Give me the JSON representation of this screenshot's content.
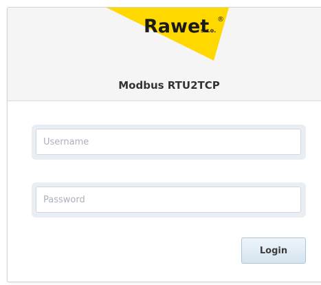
{
  "branding": {
    "logo_word": "Rawet",
    "logo_suffix": "s.r.o.",
    "logo_mark": "®",
    "logo_color": "#ffd800",
    "logo_text_color": "#1a1a1a"
  },
  "header": {
    "title": "Modbus RTU2TCP"
  },
  "form": {
    "username_placeholder": "Username",
    "username_value": "",
    "password_placeholder": "Password",
    "password_value": "",
    "login_label": "Login"
  },
  "colors": {
    "header_bg": "#f5f5f5",
    "field_outline_bg": "#e8eef4",
    "button_border": "#a9c4d8"
  }
}
